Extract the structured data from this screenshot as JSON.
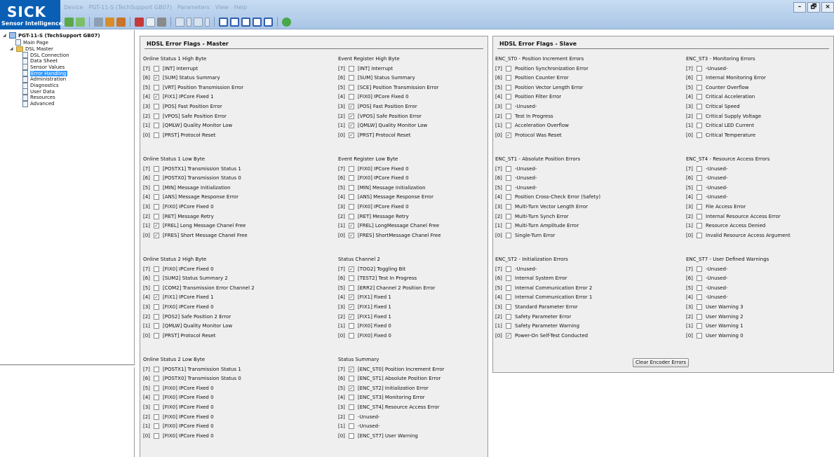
{
  "logo": {
    "text": "SICK",
    "subtitle": "Sensor Intelligence."
  },
  "menu": [
    "Device",
    "PGT-11-S (TechSupport GB07)",
    "Parameters",
    "View",
    "Help"
  ],
  "window_controls": [
    "–",
    "🗗",
    "×"
  ],
  "colors": {
    "brand": "#0a5fb4",
    "selection": "#3399ff",
    "panel_bg": "#efefef"
  },
  "tree": {
    "root": "PGT-11-S (TechSupport GB07)",
    "main_page": "Main Page",
    "folder": "DSL Master",
    "items": [
      "DSL Connection",
      "Data Sheet",
      "Sensor Values",
      "Error Handling",
      "Administration",
      "Diagnostics",
      "User Data",
      "Resources",
      "Advanced"
    ],
    "selected": "Error Handling"
  },
  "master": {
    "title": "HDSL Error Flags - Master",
    "groups": [
      {
        "title": "Online Status 1 High Byte",
        "rows": [
          {
            "idx": "[7]",
            "checked": false,
            "label": "[INT]  Interrupt"
          },
          {
            "idx": "[6]",
            "checked": true,
            "label": "[SUM]  Status Summary"
          },
          {
            "idx": "[5]",
            "checked": false,
            "label": "[VRT]  Position Transmission Error"
          },
          {
            "idx": "[4]",
            "checked": true,
            "label": "[FIX1]  IPCore Fixed 1"
          },
          {
            "idx": "[3]",
            "checked": false,
            "label": "[POS]  Fast Position Error"
          },
          {
            "idx": "[2]",
            "checked": false,
            "label": "[VPOS]  Safe Position Error"
          },
          {
            "idx": "[1]",
            "checked": false,
            "label": "[QMLW]  Quality Monitor Low"
          },
          {
            "idx": "[0]",
            "checked": false,
            "label": "[PRST]  Protocol Reset"
          }
        ]
      },
      {
        "title": "Event Register High Byte",
        "rows": [
          {
            "idx": "[7]",
            "checked": false,
            "label": "[INT]  Interrupt"
          },
          {
            "idx": "[6]",
            "checked": false,
            "label": "[SUM]  Status Summary"
          },
          {
            "idx": "[5]",
            "checked": false,
            "label": "[SCE]  Position Transmission Error"
          },
          {
            "idx": "[4]",
            "checked": false,
            "label": "[FIX0]  IPCore Fixed 0"
          },
          {
            "idx": "[3]",
            "checked": true,
            "label": "[POS]  Fast Position Error"
          },
          {
            "idx": "[2]",
            "checked": true,
            "label": "[VPOS]  Safe Position Error"
          },
          {
            "idx": "[1]",
            "checked": true,
            "label": "[QMLW]  Quality Monitor Low"
          },
          {
            "idx": "[0]",
            "checked": true,
            "label": "[PRST]  Protocol Reset"
          }
        ]
      },
      {
        "title": "Online Status 1 Low Byte",
        "rows": [
          {
            "idx": "[7]",
            "checked": false,
            "label": "[POSTX1]  Transmission Status 1"
          },
          {
            "idx": "[6]",
            "checked": false,
            "label": "[POSTX0]  Transmission Status 0"
          },
          {
            "idx": "[5]",
            "checked": false,
            "label": "[MIN]  Message Initialization"
          },
          {
            "idx": "[4]",
            "checked": false,
            "label": "[ANS]  Message Response Error"
          },
          {
            "idx": "[3]",
            "checked": false,
            "label": "[FIX0]  IPCore Fixed 0"
          },
          {
            "idx": "[2]",
            "checked": false,
            "label": "[RET]  Message Retry"
          },
          {
            "idx": "[1]",
            "checked": true,
            "label": "[FREL]  Long Message Chanel Free"
          },
          {
            "idx": "[0]",
            "checked": true,
            "label": "[FRES]  Short Message Chanel Free"
          }
        ]
      },
      {
        "title": "Event Register Low Byte",
        "rows": [
          {
            "idx": "[7]",
            "checked": false,
            "label": "[FIX0]  IPCore Fixed 0"
          },
          {
            "idx": "[6]",
            "checked": false,
            "label": "[FIX0]  IPCore Fixed 0"
          },
          {
            "idx": "[5]",
            "checked": false,
            "label": "[MIN]  Message Initialization"
          },
          {
            "idx": "[4]",
            "checked": false,
            "label": "[ANS]  Message Response Error"
          },
          {
            "idx": "[3]",
            "checked": false,
            "label": "[FIX0]  IPCore Fixed 0"
          },
          {
            "idx": "[2]",
            "checked": false,
            "label": "[RET]  Message Retry"
          },
          {
            "idx": "[1]",
            "checked": true,
            "label": "[FREL]  LongMessage Chanel Free"
          },
          {
            "idx": "[0]",
            "checked": true,
            "label": "[FRES]  ShortMessage Chanel Free"
          }
        ]
      },
      {
        "title": "Online Status 2 High Byte",
        "rows": [
          {
            "idx": "[7]",
            "checked": false,
            "label": "[FIX0]  IPCore Fixed 0"
          },
          {
            "idx": "[6]",
            "checked": false,
            "label": "[SUM2]  Status Summary 2"
          },
          {
            "idx": "[5]",
            "checked": false,
            "label": "[COM2]  Transmission Error Channel 2"
          },
          {
            "idx": "[4]",
            "checked": true,
            "label": "[FIX1]  IPCore Fixed 1"
          },
          {
            "idx": "[3]",
            "checked": false,
            "label": "[FIX0]  IPCore Fixed 0"
          },
          {
            "idx": "[2]",
            "checked": false,
            "label": "[POS2]  Safe Position 2 Error"
          },
          {
            "idx": "[1]",
            "checked": false,
            "label": "[QMLW]  Quality Monitor Low"
          },
          {
            "idx": "[0]",
            "checked": false,
            "label": "[PRST]  Protocol Reset"
          }
        ]
      },
      {
        "title": "Status Channel 2",
        "rows": [
          {
            "idx": "[7]",
            "checked": true,
            "label": "[TOG2]  Toggling Bit"
          },
          {
            "idx": "[6]",
            "checked": false,
            "label": "[TEST2]  Test In Progress"
          },
          {
            "idx": "[5]",
            "checked": false,
            "label": "[ERR2]  Channel 2 Position Error"
          },
          {
            "idx": "[4]",
            "checked": true,
            "label": "[FIX1]  Fixed 1"
          },
          {
            "idx": "[3]",
            "checked": true,
            "label": "[FIX1]  Fixed 1"
          },
          {
            "idx": "[2]",
            "checked": true,
            "label": "[FIX1]  Fixed 1"
          },
          {
            "idx": "[1]",
            "checked": false,
            "label": "[FIX0]  Fixed 0"
          },
          {
            "idx": "[0]",
            "checked": false,
            "label": "[FIX0]  Fixed 0"
          }
        ]
      },
      {
        "title": "Online Status 2 Low Byte",
        "rows": [
          {
            "idx": "[7]",
            "checked": false,
            "label": "[POSTX1]  Transmission Status 1"
          },
          {
            "idx": "[6]",
            "checked": false,
            "label": "[POSTX0]  Transmission Status 0"
          },
          {
            "idx": "[5]",
            "checked": false,
            "label": "[FIX0]  IPCore Fixed 0"
          },
          {
            "idx": "[4]",
            "checked": false,
            "label": "[FIX0]  IPCore Fixed 0"
          },
          {
            "idx": "[3]",
            "checked": false,
            "label": "[FIX0]  IPCore Fixed 0"
          },
          {
            "idx": "[2]",
            "checked": false,
            "label": "[FIX0]  IPCore Fixed 0"
          },
          {
            "idx": "[1]",
            "checked": false,
            "label": "[FIX0]  IPCore Fixed 0"
          },
          {
            "idx": "[0]",
            "checked": false,
            "label": "[FIX0]  IPCore Fixed 0"
          }
        ]
      },
      {
        "title": "Status Summary",
        "rows": [
          {
            "idx": "[7]",
            "checked": true,
            "label": "[ENC_ST0] Position Increment Error"
          },
          {
            "idx": "[6]",
            "checked": false,
            "label": "[ENC_ST1] Absolute Position Error"
          },
          {
            "idx": "[5]",
            "checked": true,
            "label": "[ENC_ST2] Initialization Error"
          },
          {
            "idx": "[4]",
            "checked": false,
            "label": "[ENC_ST3] Monitoring Error"
          },
          {
            "idx": "[3]",
            "checked": false,
            "label": "[ENC_ST4] Resource Access Error"
          },
          {
            "idx": "[2]",
            "checked": false,
            "label": "-Unused-"
          },
          {
            "idx": "[1]",
            "checked": false,
            "label": "-Unused-"
          },
          {
            "idx": "[0]",
            "checked": false,
            "label": "[ENC_ST7] User Warning"
          }
        ]
      }
    ]
  },
  "slave": {
    "title": "HDSL Error Flags - Slave",
    "clear_button": "Clear Encoder Errors",
    "groups": [
      {
        "title": "ENC_ST0 - Position Increment Errors",
        "rows": [
          {
            "idx": "[7]",
            "checked": false,
            "label": "Position Synchronization Error"
          },
          {
            "idx": "[6]",
            "checked": false,
            "label": "Position Counter Error"
          },
          {
            "idx": "[5]",
            "checked": false,
            "label": "Position Vector Length Error"
          },
          {
            "idx": "[4]",
            "checked": false,
            "label": "Position Filter Error"
          },
          {
            "idx": "[3]",
            "checked": false,
            "label": "-Unused-"
          },
          {
            "idx": "[2]",
            "checked": false,
            "label": "Test In Progress"
          },
          {
            "idx": "[1]",
            "checked": false,
            "label": "Acceleration Overflow"
          },
          {
            "idx": "[0]",
            "checked": true,
            "label": "Protocol Was Reset"
          }
        ]
      },
      {
        "title": "ENC_ST3 - Monitoring Errors",
        "rows": [
          {
            "idx": "[7]",
            "checked": false,
            "label": "-Unused-"
          },
          {
            "idx": "[6]",
            "checked": false,
            "label": "Internal Monitoring Error"
          },
          {
            "idx": "[5]",
            "checked": false,
            "label": "Counter Overflow"
          },
          {
            "idx": "[4]",
            "checked": false,
            "label": "Critical Acceleration"
          },
          {
            "idx": "[3]",
            "checked": false,
            "label": "Critical Speed"
          },
          {
            "idx": "[2]",
            "checked": false,
            "label": "Critical Supply Voltage"
          },
          {
            "idx": "[1]",
            "checked": false,
            "label": "Critical LED Current"
          },
          {
            "idx": "[0]",
            "checked": false,
            "label": "Critical Temperature"
          }
        ]
      },
      {
        "title": "ENC_ST1 - Absolute Position Errors",
        "rows": [
          {
            "idx": "[7]",
            "checked": false,
            "label": "-Unused-"
          },
          {
            "idx": "[6]",
            "checked": false,
            "label": "-Unused-"
          },
          {
            "idx": "[5]",
            "checked": false,
            "label": "-Unused-"
          },
          {
            "idx": "[4]",
            "checked": false,
            "label": "Position Cross-Check Error (Safety)"
          },
          {
            "idx": "[3]",
            "checked": false,
            "label": "Multi-Turn Vector Length Error"
          },
          {
            "idx": "[2]",
            "checked": false,
            "label": "Multi-Turn Synch Error"
          },
          {
            "idx": "[1]",
            "checked": false,
            "label": "Multi-Turn Amplitude Error"
          },
          {
            "idx": "[0]",
            "checked": false,
            "label": "Single-Turn Error"
          }
        ]
      },
      {
        "title": "ENC_ST4 - Resource Access Errors",
        "rows": [
          {
            "idx": "[7]",
            "checked": false,
            "label": "-Unused-"
          },
          {
            "idx": "[6]",
            "checked": false,
            "label": "-Unused-"
          },
          {
            "idx": "[5]",
            "checked": false,
            "label": "-Unused-"
          },
          {
            "idx": "[4]",
            "checked": false,
            "label": "-Unused-"
          },
          {
            "idx": "[3]",
            "checked": false,
            "label": "File Access Error"
          },
          {
            "idx": "[2]",
            "checked": false,
            "label": "Internal Resource Access Error"
          },
          {
            "idx": "[1]",
            "checked": false,
            "label": "Resource Access Denied"
          },
          {
            "idx": "[0]",
            "checked": false,
            "label": "Invalid Resource Access Argument"
          }
        ]
      },
      {
        "title": "ENC_ST2 - Initialization Errors",
        "rows": [
          {
            "idx": "[7]",
            "checked": false,
            "label": "-Unused-"
          },
          {
            "idx": "[6]",
            "checked": false,
            "label": "Internal System Error"
          },
          {
            "idx": "[5]",
            "checked": false,
            "label": "Internal Communication Error 2"
          },
          {
            "idx": "[4]",
            "checked": false,
            "label": "Internal Communication Error 1"
          },
          {
            "idx": "[3]",
            "checked": false,
            "label": "Standard Parameter Error"
          },
          {
            "idx": "[2]",
            "checked": false,
            "label": "Safety Parameter Error"
          },
          {
            "idx": "[1]",
            "checked": false,
            "label": "Safety Parameter Warning"
          },
          {
            "idx": "[0]",
            "checked": true,
            "label": "Power-On Self-Test Conducted"
          }
        ]
      },
      {
        "title": "ENC_ST7 - User Defined Warnings",
        "rows": [
          {
            "idx": "[7]",
            "checked": false,
            "label": "-Unused-"
          },
          {
            "idx": "[6]",
            "checked": false,
            "label": "-Unused-"
          },
          {
            "idx": "[5]",
            "checked": false,
            "label": "-Unused-"
          },
          {
            "idx": "[4]",
            "checked": false,
            "label": "-Unused-"
          },
          {
            "idx": "[3]",
            "checked": false,
            "label": "User Warning 3"
          },
          {
            "idx": "[2]",
            "checked": false,
            "label": "User Warning 2"
          },
          {
            "idx": "[1]",
            "checked": false,
            "label": "User Warning 1"
          },
          {
            "idx": "[0]",
            "checked": false,
            "label": "User Warning 0"
          }
        ]
      }
    ]
  }
}
